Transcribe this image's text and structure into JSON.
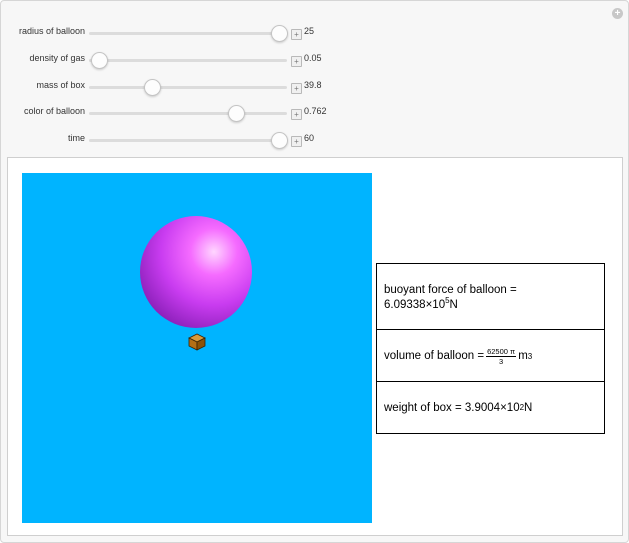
{
  "controls": [
    {
      "label": "radius of balloon",
      "value": "25",
      "fraction": 0.96
    },
    {
      "label": "density of gas",
      "value": "0.05",
      "fraction": 0.05
    },
    {
      "label": "mass of box",
      "value": "39.8",
      "fraction": 0.32
    },
    {
      "label": "color of balloon",
      "value": "0.762",
      "fraction": 0.74
    },
    {
      "label": "time",
      "value": "60",
      "fraction": 0.96
    }
  ],
  "scene": {
    "background_color": "#00b4ff",
    "balloon_color": "#e04cf8"
  },
  "info": {
    "buoyant_label": "buoyant force of balloon =",
    "buoyant_mantissa": "6.09338",
    "buoyant_times": "×",
    "buoyant_base": "10",
    "buoyant_exp": "5",
    "buoyant_unit": "N",
    "volume_label": "volume of balloon =",
    "volume_num": "62500 π",
    "volume_den": "3",
    "volume_unit": "m",
    "volume_exp": "3",
    "weight_label": "weight of box =",
    "weight_mantissa": "3.9004",
    "weight_times": "×",
    "weight_base": "10",
    "weight_exp": "2",
    "weight_unit": "N"
  },
  "icons": {
    "corner": "plus-circle-icon",
    "stepper": "plus-square-icon"
  }
}
